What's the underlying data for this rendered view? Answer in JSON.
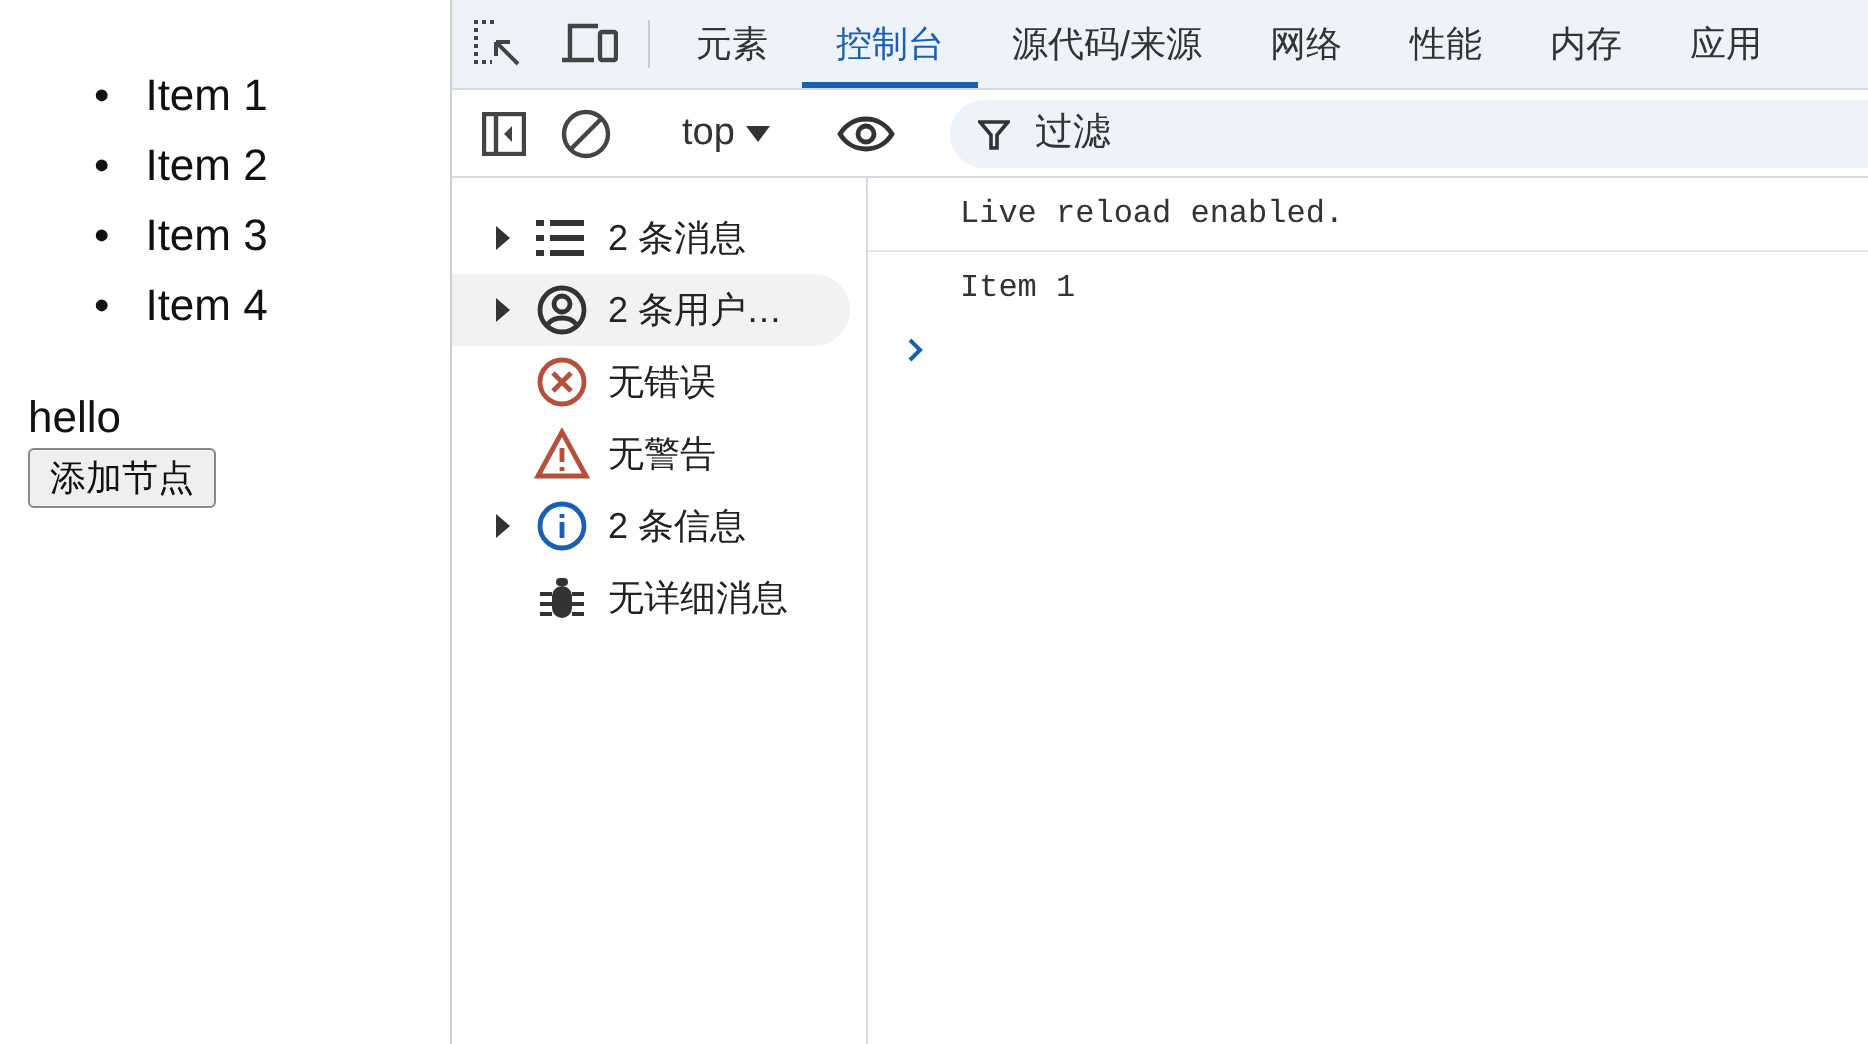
{
  "page": {
    "list_items": [
      {
        "bullet": "•",
        "text": "Item 1"
      },
      {
        "bullet": "•",
        "text": "Item 2"
      },
      {
        "bullet": "•",
        "text": "Item 3"
      },
      {
        "bullet": "•",
        "text": "Item 4"
      }
    ],
    "paragraph": "hello",
    "button": "添加节点"
  },
  "devtools": {
    "tabs": [
      {
        "label": "元素",
        "selected": false
      },
      {
        "label": "控制台",
        "selected": true
      },
      {
        "label": "源代码/来源",
        "selected": false
      },
      {
        "label": "网络",
        "selected": false
      },
      {
        "label": "性能",
        "selected": false
      },
      {
        "label": "内存",
        "selected": false
      },
      {
        "label": "应用",
        "selected": false
      }
    ],
    "context": "top",
    "filter": {
      "placeholder": "过滤"
    },
    "sidebar": [
      {
        "kind": "messages",
        "label": "2 条消息",
        "expandable": true,
        "selected": false
      },
      {
        "kind": "user",
        "label": "2 条用户…",
        "expandable": true,
        "selected": true
      },
      {
        "kind": "error",
        "label": "无错误",
        "expandable": false,
        "selected": false
      },
      {
        "kind": "warning",
        "label": "无警告",
        "expandable": false,
        "selected": false
      },
      {
        "kind": "info",
        "label": "2 条信息",
        "expandable": true,
        "selected": false
      },
      {
        "kind": "verbose",
        "label": "无详细消息",
        "expandable": false,
        "selected": false
      }
    ],
    "console": [
      "Live reload enabled.",
      "Item 1"
    ]
  }
}
